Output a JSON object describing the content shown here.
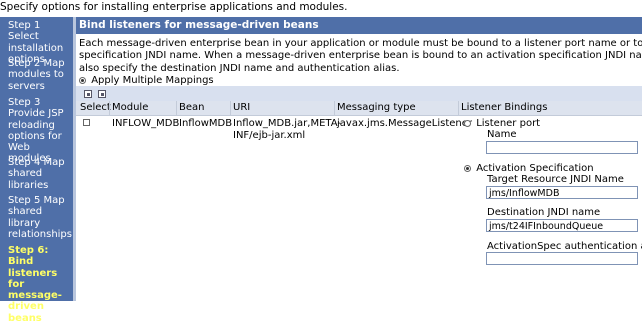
{
  "intro": "Specify options for installing enterprise applications and modules.",
  "steps": [
    {
      "num": "Step 1",
      "rest": " Select installation options",
      "lines": [
        "Step 1 Select",
        "installation",
        "options"
      ]
    },
    {
      "lines": [
        "Step 2 Map",
        "modules to",
        "servers"
      ]
    },
    {
      "lines": [
        "Step 3",
        "Provide JSP",
        "reloading",
        "options for",
        "Web modules"
      ]
    },
    {
      "lines": [
        "Step 4 Map",
        "shared",
        "libraries"
      ]
    },
    {
      "lines": [
        "Step 5 Map",
        "shared",
        "library",
        "relationships"
      ]
    },
    {
      "lines": [
        "Step 6: Bind",
        "listeners for",
        "message-",
        "driven",
        "beans"
      ]
    }
  ],
  "main": {
    "title": "Bind listeners for message-driven beans",
    "description": "Each message-driven enterprise bean in your application or module must be bound to a listener port name or to an activation\nspecification JNDI name. When a message-driven enterprise bean is bound to an activation specification JNDI name you can\nalso specify the destination JNDI name and authentication alias.",
    "apply_label": "Apply Multiple Mappings"
  },
  "table": {
    "headers": [
      "Select",
      "Module",
      "Bean",
      "URI",
      "Messaging type",
      "Listener Bindings"
    ],
    "row": {
      "module": "INFLOW_MDB",
      "bean": "InflowMDB",
      "uri": "Inflow_MDB.jar,META-\nINF/ejb-jar.xml",
      "messaging_type": "javax.jms.MessageListener"
    }
  },
  "bindings": {
    "listener_port_label": "Listener port",
    "name_label": "Name",
    "name_value": "",
    "activation_label": "Activation Specification",
    "target_jndi_label": "Target Resource JNDI Name",
    "target_jndi_value": "jms/InflowMDB",
    "dest_jndi_label": "Destination JNDI name",
    "dest_jndi_value": "jms/t24IFInboundQueue",
    "auth_alias_label": "ActivationSpec authentication alias",
    "auth_alias_value": ""
  }
}
